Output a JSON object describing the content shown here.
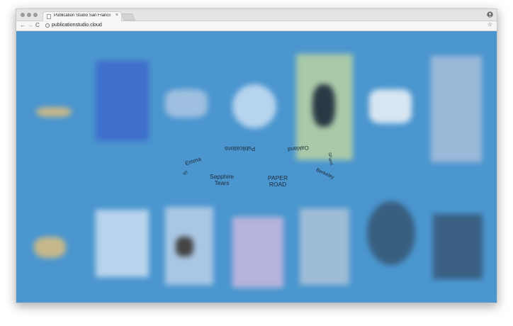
{
  "browser": {
    "tab_title": "Publication Studio San Francisco",
    "tab_close": "×",
    "url": "publicationstudio.cloud",
    "nav": {
      "back": "←",
      "forward": "→",
      "reload": "C"
    },
    "star": "☆"
  },
  "page": {
    "circle_labels": [
      "Emma",
      "Publications",
      "Oakland",
      "Berkeley",
      "and",
      "SF",
      "by"
    ],
    "center_items": [
      {
        "line1": "Sapphire",
        "line2": "Tears"
      },
      {
        "line1": "PAPER",
        "line2": "ROAD"
      }
    ]
  },
  "colors": {
    "page_background": "#4b96cf",
    "text": "#1e2a38"
  }
}
